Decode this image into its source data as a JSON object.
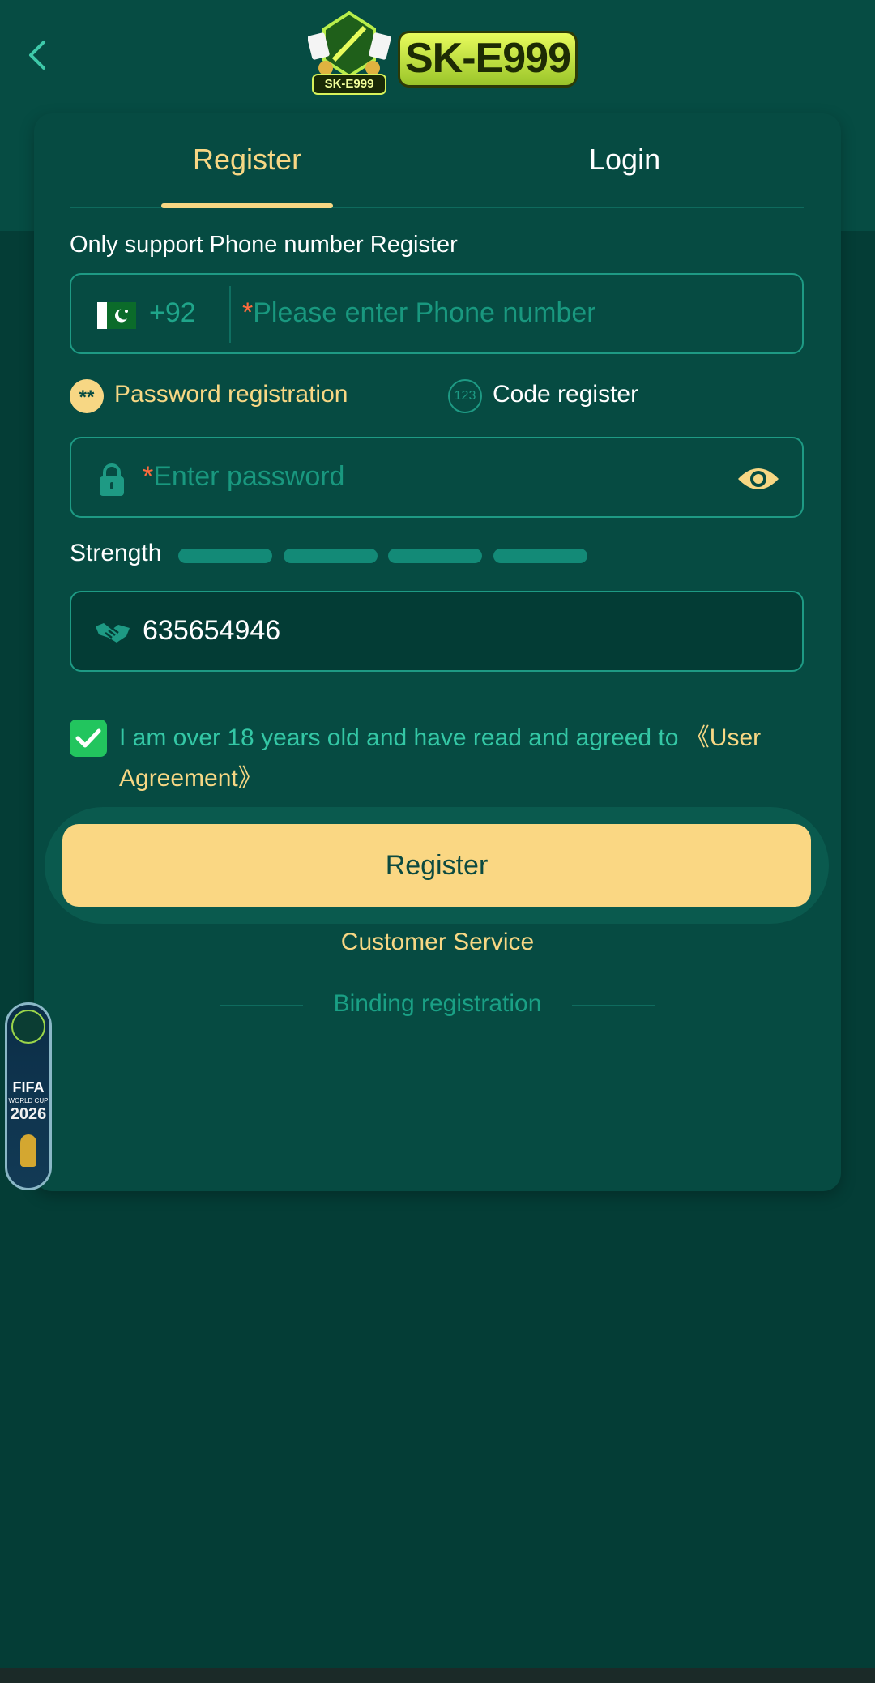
{
  "header": {
    "logo_text": "SK-E999",
    "emblem_text": "SK-E999"
  },
  "tabs": {
    "register": "Register",
    "login": "Login"
  },
  "form": {
    "hint": "Only support Phone number Register",
    "phone": {
      "country": "Pakistan",
      "prefix": "+92",
      "required_mark": "*",
      "placeholder": "Please enter Phone number"
    },
    "modes": {
      "password": "Password registration",
      "password_icon": "**",
      "code": "Code register",
      "code_icon": "123"
    },
    "password": {
      "required_mark": "*",
      "placeholder": "Enter password"
    },
    "strength": {
      "label": "Strength",
      "level": 0
    },
    "invite_code": "635654946",
    "agreement": {
      "checked": true,
      "text": "I am over 18 years old and have read and agreed to ",
      "link": "《User Agreement》"
    },
    "register_button": "Register",
    "customer_service": "Customer Service",
    "binding": "Binding registration"
  },
  "floating_banner": {
    "title": "FIFA",
    "subtitle": "WORLD CUP",
    "year": "2026"
  },
  "colors": {
    "background": "#043d36",
    "card": "#064b42",
    "accent": "#f7d784",
    "teal": "#1e9a84",
    "check": "#22c55e"
  }
}
